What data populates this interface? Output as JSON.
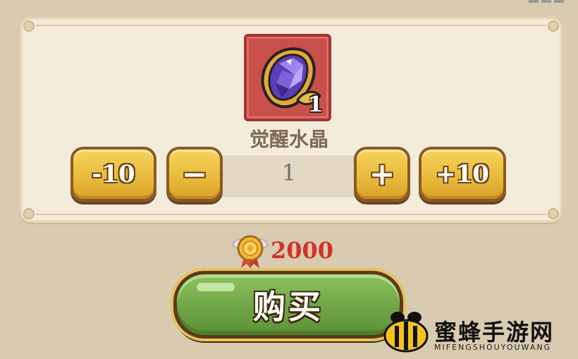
{
  "item": {
    "icon": "awakening-crystal-icon",
    "count": "1",
    "name": "觉醒水晶",
    "card_color": "#c94f4b"
  },
  "quantity": {
    "minus10_label": "-10",
    "minus_label": "−",
    "value": "1",
    "plus_label": "+",
    "plus10_label": "+10"
  },
  "price": {
    "currency_icon": "medal-coin-icon",
    "amount": "2000",
    "color": "#d0322a"
  },
  "buy": {
    "label": "购买",
    "color": "#6fa545"
  },
  "watermark": {
    "logo_icon": "bee-icon",
    "title": "蜜蜂手游网",
    "subtitle": "MIFENGSHOUYOUWANG"
  }
}
